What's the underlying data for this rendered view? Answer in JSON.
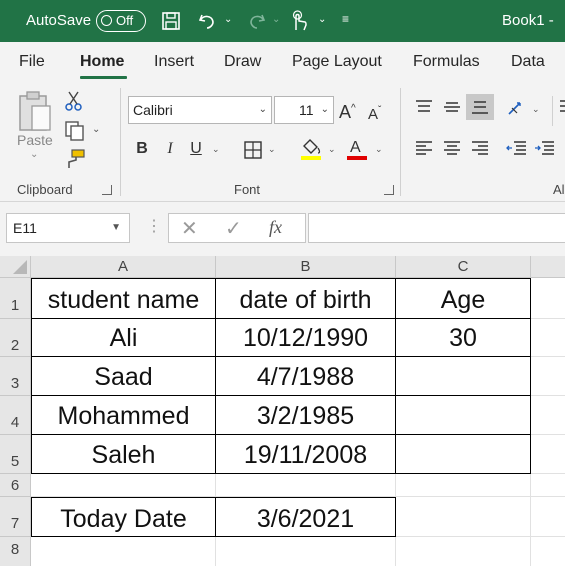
{
  "titlebar": {
    "autosave_label": "AutoSave",
    "toggle_state": "Off",
    "book_title": "Book1  -"
  },
  "tabs": [
    "File",
    "Home",
    "Insert",
    "Draw",
    "Page Layout",
    "Formulas",
    "Data"
  ],
  "ribbon": {
    "clipboard": {
      "label": "Clipboard",
      "paste_label": "Paste"
    },
    "font": {
      "label": "Font",
      "font_name": "Calibri",
      "font_size": "11",
      "bold": "B",
      "italic": "I",
      "underline": "U"
    },
    "alignment": {
      "label_partial": "Al"
    }
  },
  "formula_bar": {
    "name_box": "E11",
    "fx": "fx",
    "formula": ""
  },
  "grid": {
    "columns": [
      "A",
      "B",
      "C"
    ],
    "rows": [
      "1",
      "2",
      "3",
      "4",
      "5",
      "6",
      "7",
      "8"
    ],
    "cells": {
      "A1": "student name",
      "B1": "date of birth",
      "C1": "Age",
      "A2": "Ali",
      "B2": "10/12/1990",
      "C2": "30",
      "A3": "Saad",
      "B3": "4/7/1988",
      "C3": "",
      "A4": "Mohammed",
      "B4": "3/2/1985",
      "C4": "",
      "A5": "Saleh",
      "B5": "19/11/2008",
      "C5": "",
      "A7": "Today Date",
      "B7": "3/6/2021"
    }
  },
  "colors": {
    "excel_green": "#217346",
    "underline_red": "#e00000",
    "highlight_yellow": "#ffff00"
  }
}
